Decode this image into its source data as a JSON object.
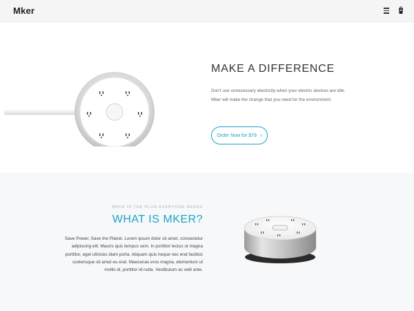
{
  "header": {
    "logo": "Mker",
    "menu_icon": "hamburger-menu-icon",
    "cart_icon": "cart-icon"
  },
  "hero": {
    "title": "MAKE A DIFFERENCE",
    "text": "Don't use unnecessary electricity when your electric devices are idle. Mker will make the change that you need for the environment.",
    "cta_label": "Order Now for $79",
    "cta_icon": "chevron-right-icon"
  },
  "about": {
    "kicker": "MKER IS THE PLUG EVERYONE NEEDS",
    "title": "WHAT IS MKER?",
    "text": "Save Power, Save the Planet. Lorem ipsum dolor sit amet, consectetur adipiscing elit. Mauris quis tempus sem. In porttitor lectus ut magna porttitor, eget ultricies diam porta. Aliquam quis neque nec erat facilisis scelerisque sit amet eu erat. Maecenas eros magna, elementum ut mollis id, porttitor id nulla. Vestibulum ac velit ante."
  },
  "colors": {
    "accent": "#1aa3c7",
    "header_bg": "#f5f5f5",
    "section_bg": "#f7f8fa"
  }
}
